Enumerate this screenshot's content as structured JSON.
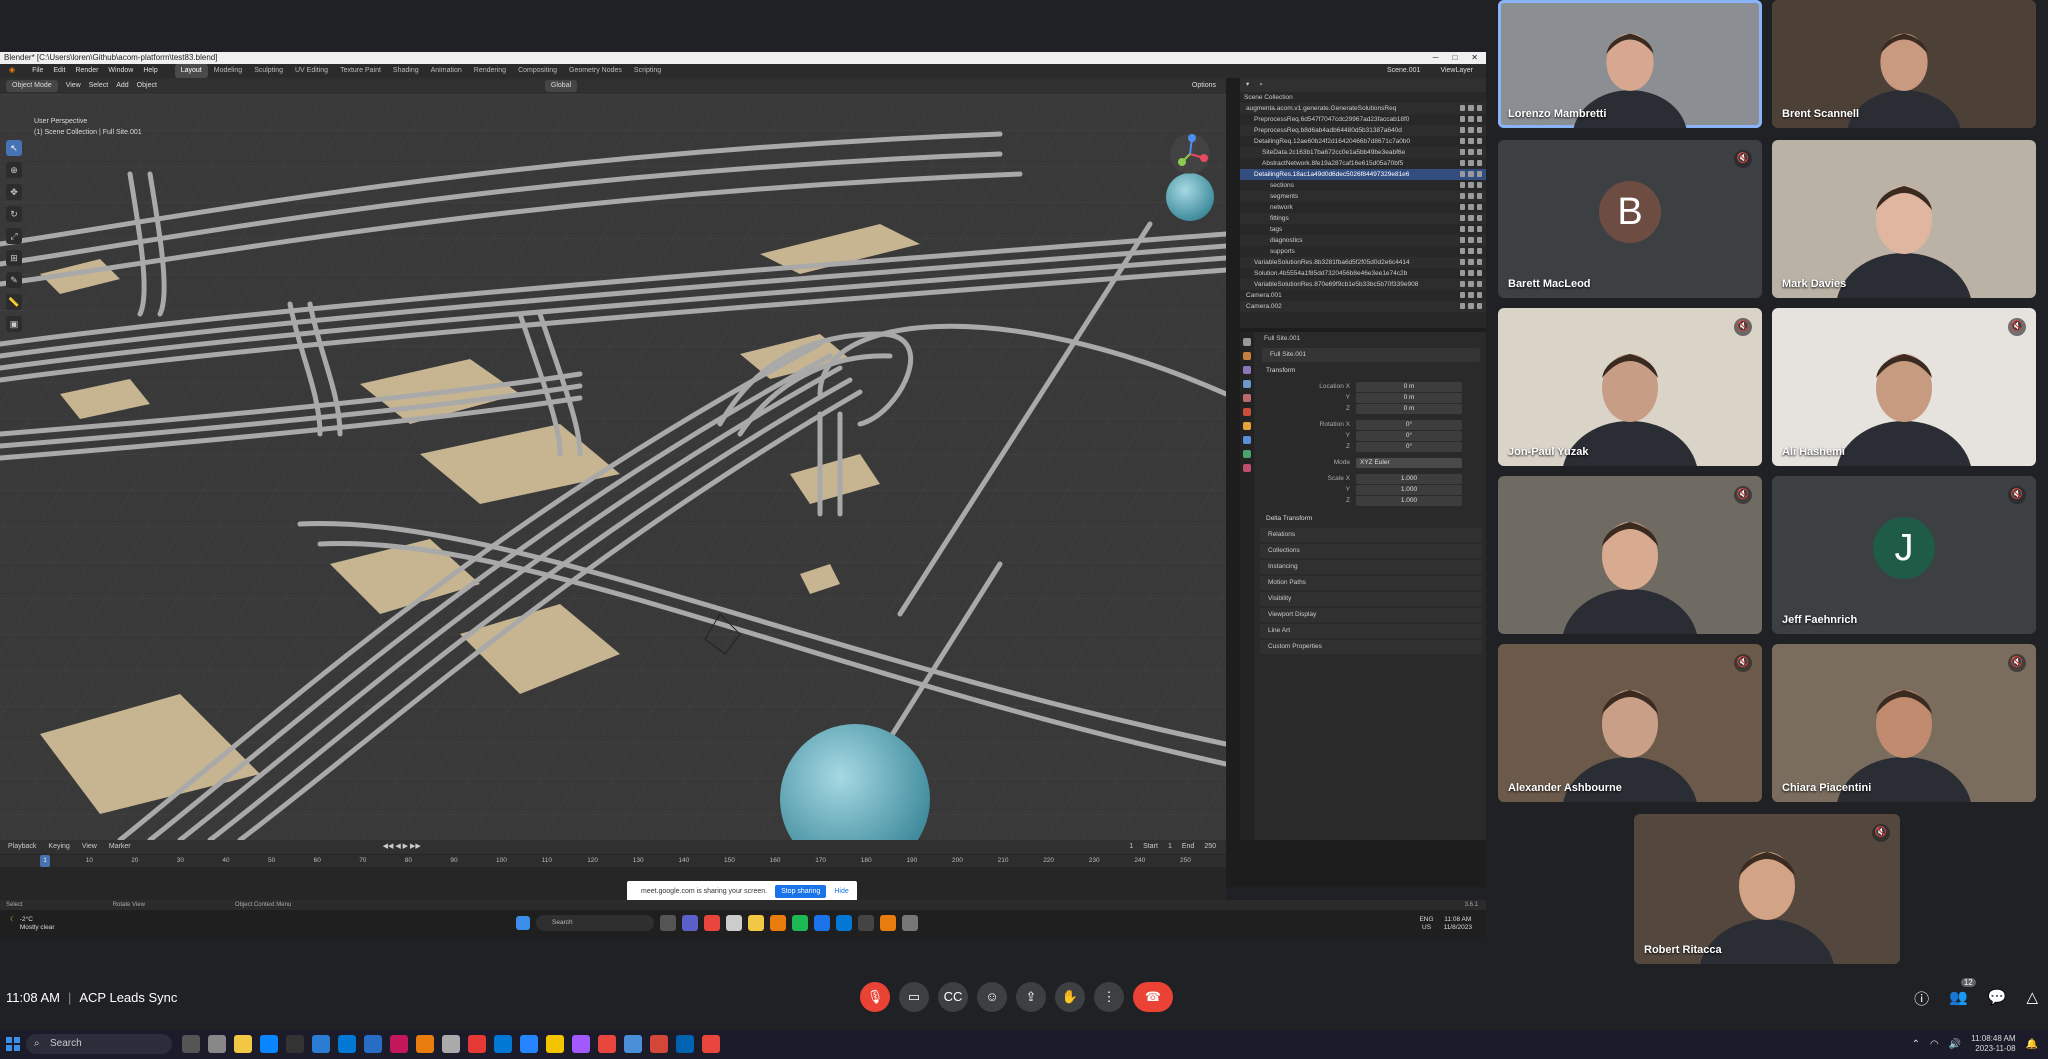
{
  "blender": {
    "window_title": "Blender* [C:\\Users\\loren\\Github\\acom-platform\\test83.blend]",
    "menus": [
      "File",
      "Edit",
      "Render",
      "Window",
      "Help"
    ],
    "workspaces": [
      "Layout",
      "Modeling",
      "Sculpting",
      "UV Editing",
      "Texture Paint",
      "Shading",
      "Animation",
      "Rendering",
      "Compositing",
      "Geometry Nodes",
      "Scripting"
    ],
    "active_workspace": "Layout",
    "scene": "Scene.001",
    "view_layer": "ViewLayer",
    "viewport": {
      "mode": "Object Mode",
      "header_menus": [
        "View",
        "Select",
        "Add",
        "Object"
      ],
      "transform_orientation": "Global",
      "options": "Options",
      "info_line1": "User Perspective",
      "info_line2": "(1) Scene Collection | Full Site.001"
    },
    "outliner": {
      "header": "Scene Collection",
      "rows": [
        "augmenta.acom.v1.generate.GenerateSolutionsReq",
        "PreprocessReq.6d547f7047cdc29967ad23faccab18f0",
        "PreprocessReq.b8d6ab4adb64480d5b31387a640d",
        "DetailingReq.12ae60b24f2d16420466b7d8671c7a0b0",
        "SiteData.2c163b17ba672cc0e1a5bb49be3eabf6e",
        "AbstractNetwork.8fe19a287caf16e615d05a70bf5",
        "DetailingRes.18ac1a49d0d6dec5026f84497329e81e6",
        "sections",
        "segments",
        "network",
        "fittings",
        "tags",
        "diagnostics",
        "supports",
        "VariableSolutionRes.8b3281fba6d5f2f05d0d2e6c4414",
        "Solution.4b5554a1f85dd7320456b8e46e3ee1e74c2b",
        "VariableSolutionRes.870e69f9cb1e5b33bc5b70f339e908",
        "Camera.001",
        "Camera.002"
      ]
    },
    "properties": {
      "title": "Full Site.001",
      "object_name": "Full Site.001",
      "transform_label": "Transform",
      "fields": [
        {
          "label": "Location X",
          "value": "0 m"
        },
        {
          "label": "Y",
          "value": "0 m"
        },
        {
          "label": "Z",
          "value": "0 m"
        },
        {
          "label": "Rotation X",
          "value": "0°"
        },
        {
          "label": "Y",
          "value": "0°"
        },
        {
          "label": "Z",
          "value": "0°"
        },
        {
          "label": "Mode",
          "value": "XYZ Euler"
        },
        {
          "label": "Scale X",
          "value": "1.000"
        },
        {
          "label": "Y",
          "value": "1.000"
        },
        {
          "label": "Z",
          "value": "1.000"
        }
      ],
      "subsection": "Delta Transform",
      "panels": [
        "Relations",
        "Collections",
        "Instancing",
        "Motion Paths",
        "Visibility",
        "Viewport Display",
        "Line Art",
        "Custom Properties"
      ]
    },
    "timeline": {
      "menus": [
        "Playback",
        "Keying",
        "View",
        "Marker"
      ],
      "current_frame": "1",
      "start_label": "Start",
      "start": "1",
      "end_label": "End",
      "end": "250",
      "ticks": [
        "1",
        "10",
        "20",
        "30",
        "40",
        "50",
        "60",
        "70",
        "80",
        "90",
        "100",
        "110",
        "120",
        "130",
        "140",
        "150",
        "160",
        "170",
        "180",
        "190",
        "200",
        "210",
        "220",
        "230",
        "240",
        "250"
      ]
    },
    "status_bar": [
      "Select",
      "Rotate View",
      "Object Context Menu"
    ],
    "version": "3.6.1"
  },
  "share_bar": {
    "text": "meet.google.com is sharing your screen.",
    "stop": "Stop sharing",
    "hide": "Hide"
  },
  "inner_taskbar": {
    "temp": "-2°C",
    "weather": "Mostly clear",
    "search_placeholder": "Search",
    "lang": "ENG",
    "region": "US",
    "time": "11:08 AM",
    "date": "11/8/2023"
  },
  "participants": [
    {
      "name": "Lorenzo Mambretti",
      "speaking": true,
      "muted": false
    },
    {
      "name": "Brent Scannell",
      "speaking": false,
      "muted": false
    },
    {
      "name": "Barett MacLeod",
      "speaking": false,
      "muted": true,
      "initial": "B",
      "color": "#6d4c41"
    },
    {
      "name": "Mark Davies",
      "speaking": false,
      "muted": false
    },
    {
      "name": "Jon-Paul Yuzak",
      "speaking": false,
      "muted": true
    },
    {
      "name": "Ali Hashemi",
      "speaking": false,
      "muted": true
    },
    {
      "name": "",
      "speaking": false,
      "muted": true
    },
    {
      "name": "Jeff Faehnrich",
      "speaking": false,
      "muted": true,
      "initial": "J",
      "color": "#1e5c47"
    },
    {
      "name": "Alexander Ashbourne",
      "speaking": false,
      "muted": true
    },
    {
      "name": "Chiara Piacentini",
      "speaking": false,
      "muted": true
    },
    {
      "name": "Robert Ritacca",
      "speaking": false,
      "muted": true
    }
  ],
  "meet": {
    "time": "11:08 AM",
    "meeting_name": "ACP Leads Sync",
    "participant_count": "12"
  },
  "taskbar": {
    "search_placeholder": "Search",
    "time": "11:08:48 AM",
    "date": "2023-11-08"
  },
  "colors": {
    "accent": "#8ab4f8",
    "end_call": "#ea4335",
    "blender_select": "#4772b3"
  }
}
